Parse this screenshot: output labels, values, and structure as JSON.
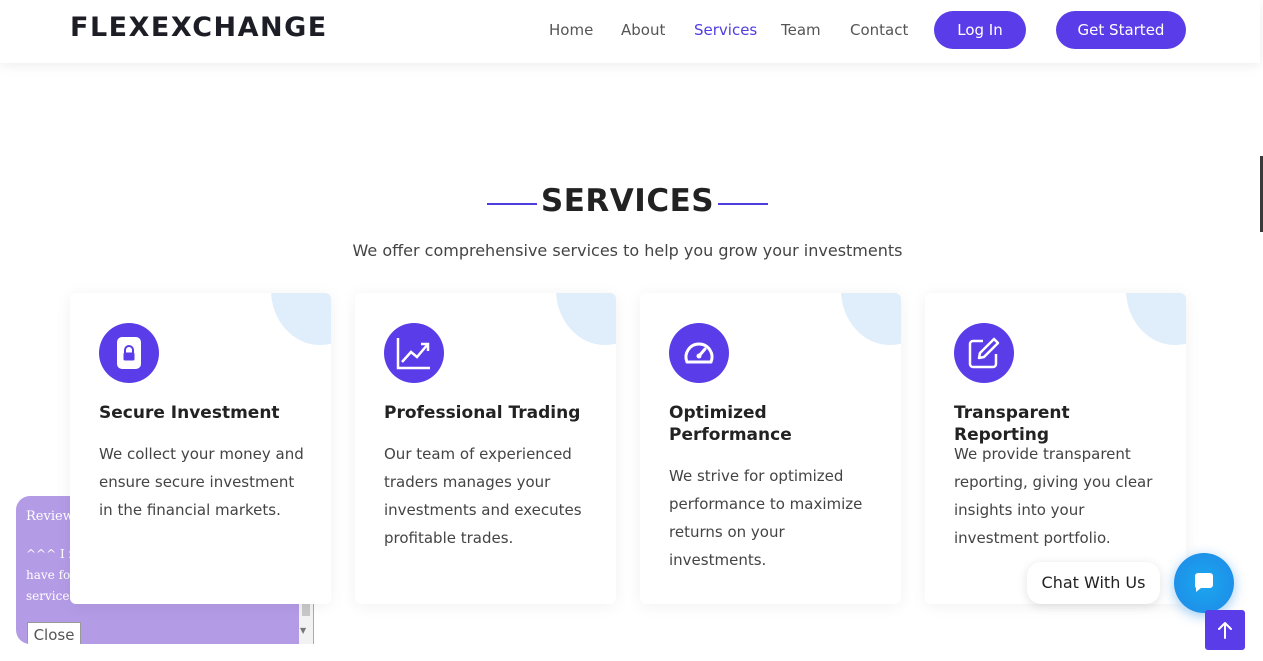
{
  "header": {
    "logo": "FLEXEXCHANGE",
    "nav": [
      {
        "label": "Home",
        "active": false
      },
      {
        "label": "About",
        "active": false
      },
      {
        "label": "Services",
        "active": true
      },
      {
        "label": "Team",
        "active": false
      },
      {
        "label": "Contact",
        "active": false
      }
    ],
    "login_label": "Log In",
    "get_started_label": "Get Started"
  },
  "services": {
    "title": "SERVICES",
    "subtitle": "We offer comprehensive services to help you grow your investments",
    "cards": [
      {
        "icon": "lock-icon",
        "title": "Secure Investment",
        "description": "We collect your money and ensure secure investment in the financial markets."
      },
      {
        "icon": "chart-line-icon",
        "title": "Professional Trading",
        "description": "Our team of experienced traders manages your investments and executes profitable trades."
      },
      {
        "icon": "speedometer-icon",
        "title": "Optimized Performance",
        "description": "We strive for optimized performance to maximize returns on your investments."
      },
      {
        "icon": "edit-icon",
        "title": "Transparent Reporting",
        "description": "We provide transparent reporting, giving you clear insights into your investment portfolio."
      }
    ]
  },
  "review_popup": {
    "title": "Review",
    "text_lines": [
      "^^^ I re",
      "have fo",
      "service"
    ],
    "close_label": "Close"
  },
  "chat": {
    "label": "Chat With Us"
  },
  "colors": {
    "accent": "#5a3de8",
    "chat": "#1e88e5",
    "corner": "#dfeefa",
    "popup": "#b49be6"
  }
}
